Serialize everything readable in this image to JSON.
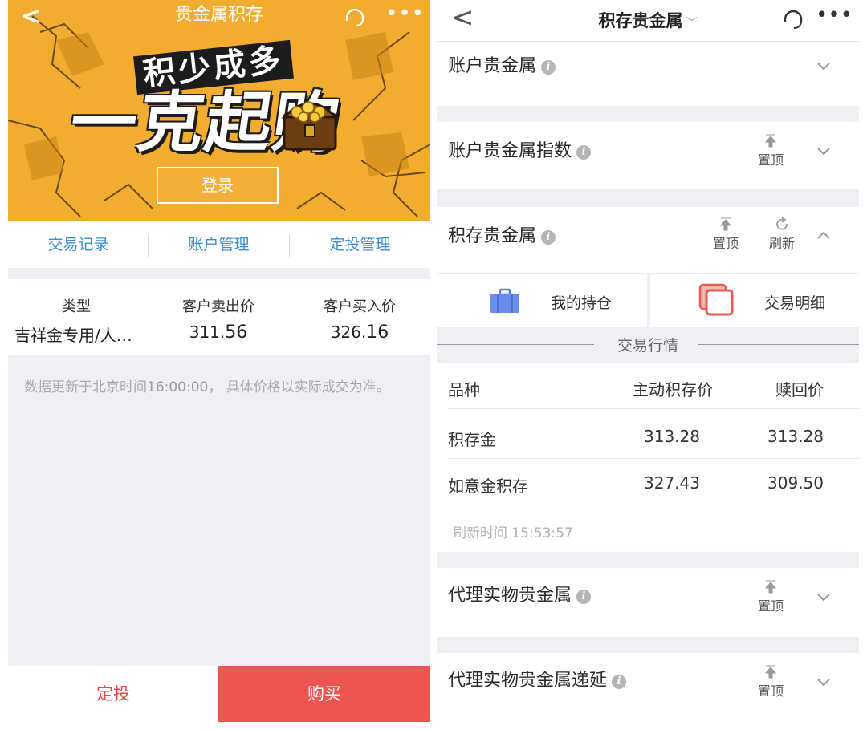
{
  "left": {
    "nav": {
      "title": "贵金属积存",
      "back_icon": "back-chevron-icon",
      "support_icon": "headset-icon",
      "more_icon": "more-dots-icon"
    },
    "banner": {
      "slogan_top": "积少成多",
      "slogan_main": "一克起购",
      "login_label": "登录",
      "bg_color": "#f2ac2f"
    },
    "tabs": [
      {
        "label": "交易记录"
      },
      {
        "label": "账户管理"
      },
      {
        "label": "定投管理"
      }
    ],
    "price_table": {
      "headers": [
        "类型",
        "客户卖出价",
        "客户买入价"
      ],
      "row": {
        "type": "吉祥金专用/人…",
        "sell_int": "311.",
        "sell_dec": "56",
        "buy_int": "326.",
        "buy_dec": "16"
      }
    },
    "notice": {
      "prefix": "数据更新于北京时间",
      "time": "16:00:00",
      "suffix": "，  具体价格以实际成交为准。"
    },
    "bottom": {
      "dingtou_label": "定投",
      "buy_label": "购买",
      "accent": "#ec5550"
    }
  },
  "right": {
    "nav": {
      "title": "积存贵金属",
      "caret": "﹀",
      "back_icon": "back-chevron-icon",
      "support_icon": "headset-icon",
      "more_icon": "more-dots-icon"
    },
    "cards": {
      "account_metal": {
        "title": "账户贵金属"
      },
      "account_index": {
        "title": "账户贵金属指数",
        "pin_label": "置顶"
      },
      "accumulate": {
        "title": "积存贵金属",
        "pin_label": "置顶",
        "refresh_label": "刷新"
      },
      "agent_physical": {
        "title": "代理实物贵金属",
        "pin_label": "置顶"
      },
      "agent_deferred": {
        "title": "代理实物贵金属递延",
        "pin_label": "置顶"
      }
    },
    "holdings": {
      "my_position": "我的持仓",
      "trade_detail": "交易明细"
    },
    "market": {
      "section_label": "交易行情",
      "headers": [
        "品种",
        "主动积存价",
        "赎回价"
      ],
      "rows": [
        {
          "name": "积存金",
          "active_price": "313.28",
          "redeem_price": "313.28"
        },
        {
          "name": "如意金积存",
          "active_price": "327.43",
          "redeem_price": "309.50"
        }
      ],
      "refresh_time": "刷新时间 15:53:57"
    },
    "info_glyph": "i"
  }
}
